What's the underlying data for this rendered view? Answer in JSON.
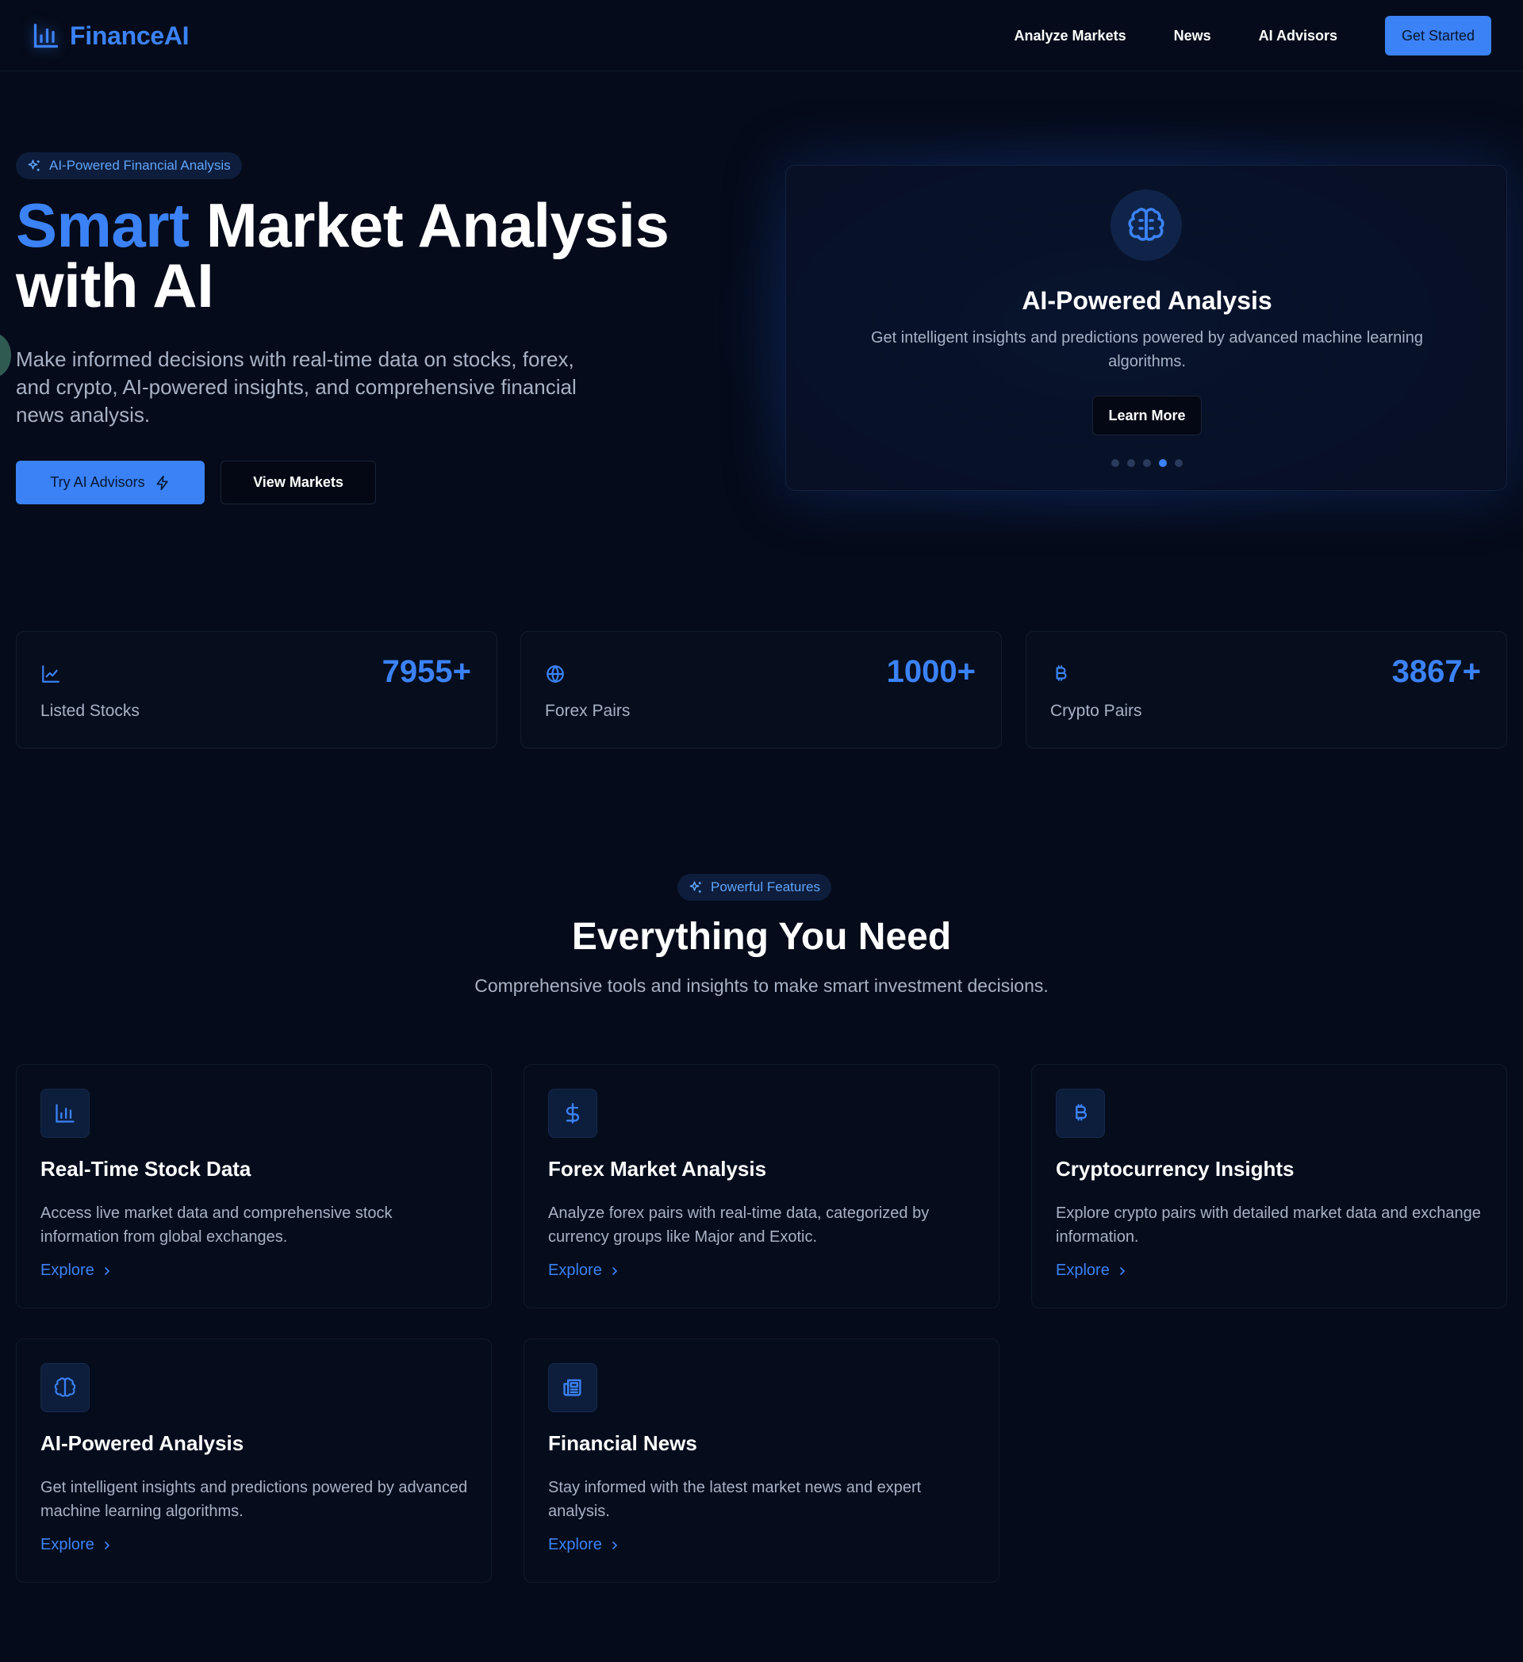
{
  "nav": {
    "brand": "FinanceAI",
    "links": [
      "Analyze Markets",
      "News",
      "AI Advisors"
    ],
    "cta": "Get Started"
  },
  "hero": {
    "badge": "AI-Powered Financial Analysis",
    "title_accent": "Smart",
    "title_line1_rest": " Market Analysis",
    "title_line2": "with AI",
    "description": "Make informed decisions with real-time data on stocks, forex, and crypto, AI-powered insights, and comprehensive financial news analysis.",
    "primary_button": "Try AI Advisors",
    "secondary_button": "View Markets"
  },
  "carousel": {
    "title": "AI-Powered Analysis",
    "description": "Get intelligent insights and predictions powered by advanced machine learning algorithms.",
    "button": "Learn More",
    "slide_count": 5,
    "active_slide": 4
  },
  "stats": [
    {
      "value": "7955+",
      "label": "Listed Stocks",
      "icon": "line-chart-icon"
    },
    {
      "value": "1000+",
      "label": "Forex Pairs",
      "icon": "globe-icon"
    },
    {
      "value": "3867+",
      "label": "Crypto Pairs",
      "icon": "bitcoin-icon"
    }
  ],
  "features": {
    "badge": "Powerful Features",
    "title": "Everything You Need",
    "subtitle": "Comprehensive tools and insights to make smart investment decisions.",
    "cards": [
      {
        "title": "Real-Time Stock Data",
        "description": "Access live market data and comprehensive stock information from global exchanges.",
        "link": "Explore",
        "icon": "bar-chart-icon"
      },
      {
        "title": "Forex Market Analysis",
        "description": "Analyze forex pairs with real-time data, categorized by currency groups like Major and Exotic.",
        "link": "Explore",
        "icon": "dollar-icon"
      },
      {
        "title": "Cryptocurrency Insights",
        "description": "Explore crypto pairs with detailed market data and exchange information.",
        "link": "Explore",
        "icon": "bitcoin-icon"
      },
      {
        "title": "AI-Powered Analysis",
        "description": "Get intelligent insights and predictions powered by advanced machine learning algorithms.",
        "link": "Explore",
        "icon": "brain-icon"
      },
      {
        "title": "Financial News",
        "description": "Stay informed with the latest market news and expert analysis.",
        "link": "Explore",
        "icon": "newspaper-icon"
      }
    ]
  },
  "colors": {
    "background": "#050b1a",
    "accent": "#3b82f6",
    "muted_text": "#a8b2c6"
  }
}
